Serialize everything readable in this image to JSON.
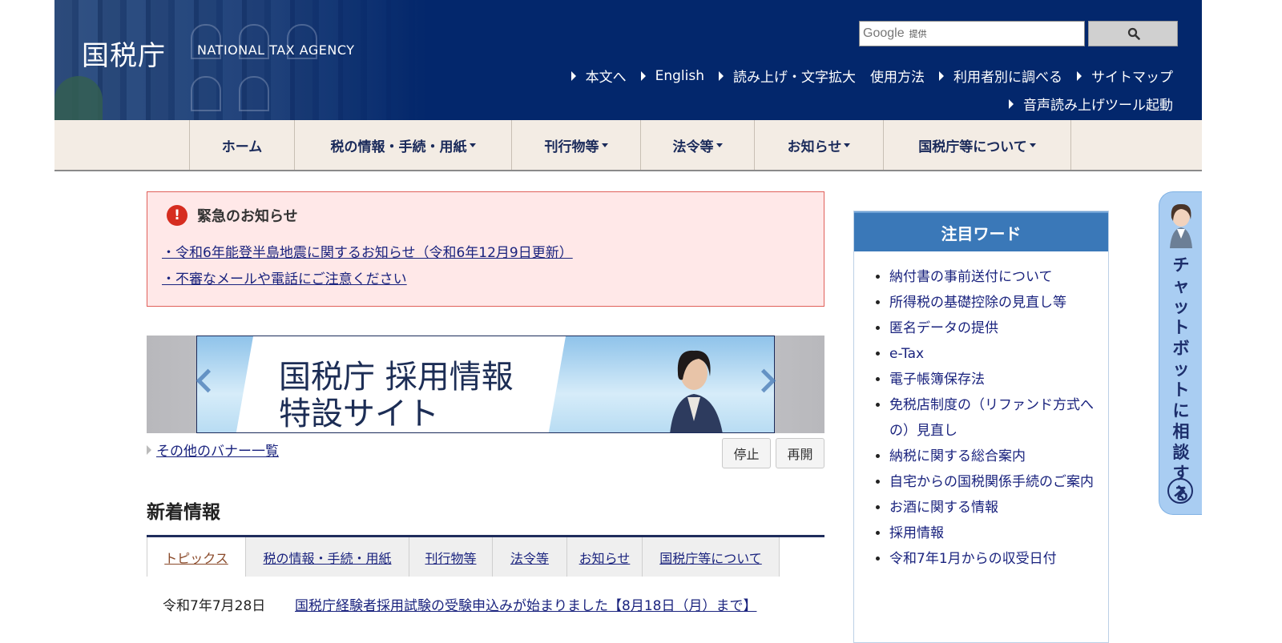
{
  "header": {
    "logo_jp": "国税庁",
    "logo_en": "NATIONAL TAX AGENCY",
    "search": {
      "brand": "Google",
      "provided": "提供",
      "placeholder": "",
      "button_icon": "magnifier-icon"
    },
    "utility_links": [
      "本文へ",
      "English",
      "読み上げ・文字拡大",
      "使用方法",
      "利用者別に調べる",
      "サイトマップ"
    ],
    "voice_tool_link": "音声読み上げツール起動"
  },
  "nav": {
    "items": [
      {
        "label": "ホーム",
        "dropdown": false
      },
      {
        "label": "税の情報・手続・用紙",
        "dropdown": true
      },
      {
        "label": "刊行物等",
        "dropdown": true
      },
      {
        "label": "法令等",
        "dropdown": true
      },
      {
        "label": "お知らせ",
        "dropdown": true
      },
      {
        "label": "国税庁等について",
        "dropdown": true
      }
    ]
  },
  "emergency": {
    "icon": "!",
    "title": "緊急のお知らせ",
    "links": [
      "・令和6年能登半島地震に関するお知らせ（令和6年12月9日更新）",
      "・不審なメールや電話にご注意ください"
    ]
  },
  "banner": {
    "line1": "国税庁 採用情報",
    "line2": "特設サイト",
    "list_link": "その他のバナー一覧",
    "stop_label": "停止",
    "resume_label": "再開"
  },
  "whats_new": {
    "heading": "新着情報",
    "tabs": [
      "トピックス",
      "税の情報・手続・用紙",
      "刊行物等",
      "法令等",
      "お知らせ",
      "国税庁等について"
    ],
    "active_tab": 0,
    "items": [
      {
        "date": "令和7年7月28日",
        "title": "国税庁経験者採用試験の受験申込みが始まりました【8月18日（月）まで】"
      }
    ]
  },
  "side_panel": {
    "title": "注目ワード",
    "items": [
      "納付書の事前送付について",
      "所得税の基礎控除の見直し等",
      "匿名データの提供",
      "e-Tax",
      "電子帳簿保存法",
      "免税店制度の（リファンド方式への）見直し",
      "納税に関する総合案内",
      "自宅からの国税関係手続のご案内",
      "お酒に関する情報",
      "採用情報",
      "令和7年1月からの収受日付"
    ]
  },
  "chatbot": {
    "label": "チャットボットに相談する"
  },
  "colors": {
    "header_bg": "#03276c",
    "nav_bg": "#f3ece4",
    "alert_bg": "#ffe8e8",
    "panel_head": "#3a78b8",
    "chatbot_bg": "#a9cdf2"
  }
}
